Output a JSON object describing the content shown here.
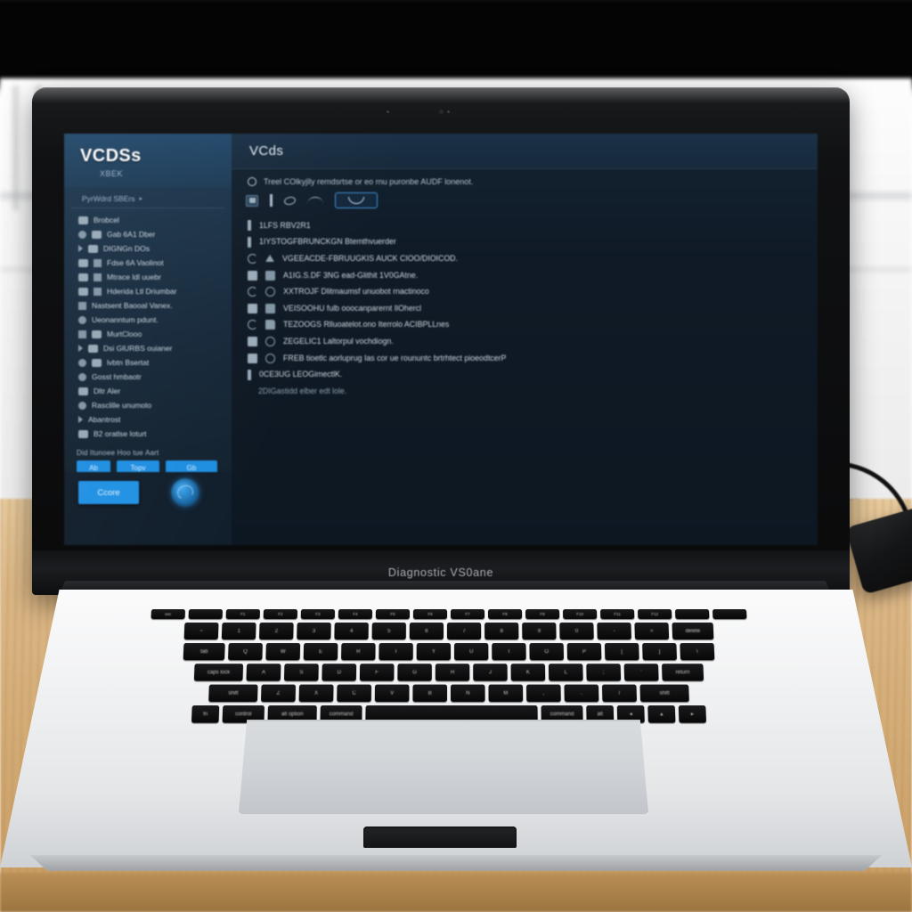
{
  "scene": {
    "device": "laptop",
    "lid_wordmark": "Diagnostic VS0ane"
  },
  "app": {
    "sidebar": {
      "title": "VCDSs",
      "subtitle": "XBEK",
      "group_label": "PyrWdrd SBErs",
      "group_caret": "▸",
      "items": [
        {
          "label": "Brobcel",
          "icon": "grid-icon"
        },
        {
          "label": "Gab 6A1 Dber",
          "icon": "cloud-icon"
        },
        {
          "label": "DIGNGn DOs",
          "icon": "key-icon"
        },
        {
          "label": "Fdse 6A Vaolinot",
          "icon": "monitor-icon"
        },
        {
          "label": "Mtrace ldl uuebr",
          "icon": "window-icon"
        },
        {
          "label": "Hderida Ltl Driumbar",
          "icon": "folder-icon"
        },
        {
          "label": "Nastsent Baooal Vanex.",
          "icon": "flag-icon"
        },
        {
          "label": "Ueonanntum pdunt.",
          "icon": "dot-icon"
        },
        {
          "label": "MurtClooo",
          "icon": "chip-icon"
        },
        {
          "label": "Dsi GlURBS ouianer",
          "icon": "car-icon"
        },
        {
          "label": "lvbtn Bsertat",
          "icon": "list-icon"
        },
        {
          "label": "Gosst hmbaotr",
          "icon": "refresh-icon"
        },
        {
          "label": "Dltr Aler",
          "icon": "image-icon"
        },
        {
          "label": "Rasclille unumoto",
          "icon": "search-icon"
        },
        {
          "label": "Abantrost",
          "icon": "pointer-icon"
        },
        {
          "label": "B2 oratlse loturt",
          "icon": "stack-icon"
        }
      ],
      "footer_label": "Did Itunoee Hoo tue Aart",
      "buttons": [
        {
          "label": "Ab"
        },
        {
          "label": "Topv"
        },
        {
          "label": "Gb"
        }
      ],
      "primary_button": "Ccore",
      "badge": "vcds-logo-badge"
    },
    "main": {
      "title": "VCds",
      "notice": "Treel COlkyjlly remdsrtse or eo rnu puronbe AUDF lonenot.",
      "toolbar": {
        "icons": [
          "screen-icon",
          "probe-icon",
          "loop-icon",
          "wave-icon"
        ],
        "selected_icon": "scan-icon"
      },
      "rows": [
        {
          "text": "1LFS RBV2R1",
          "icon1": "bar-icon",
          "icon2": ""
        },
        {
          "text": "1IYSTOGFBRUNCKGN Btemthvuerder",
          "icon1": "pin-icon",
          "icon2": ""
        },
        {
          "text": "VGEEACDE-FBRUUGKIS AUCK CIOO/DIOICOD.",
          "icon1": "cap-icon",
          "icon2": "house-icon"
        },
        {
          "text": "A1IG.S.DF 3NG ead-Glithit 1V0GAtne.",
          "icon1": "chip-icon",
          "icon2": "printer-icon"
        },
        {
          "text": "XXTROJF Dlitmaumsf unuobot rnactinoco",
          "icon1": "hook-icon",
          "icon2": "ring-icon"
        },
        {
          "text": "VEISOOHU fulb ooocanparernt IlOhercl",
          "icon1": "doc-icon",
          "icon2": "flag-icon"
        },
        {
          "text": "TEZOOGS Rlluoatelot.ono Iterrolo ACIBPLLnes",
          "icon1": "ring-icon",
          "icon2": "folder-icon"
        },
        {
          "text": "ZEGELIC1 Laltorpul vochdiogn.",
          "icon1": "car-icon",
          "icon2": "ring-icon"
        },
        {
          "text": "FREB tioetlc aorluprug Ias cor ue roununtc brtrhtect pioeodtcerP",
          "icon1": "undo-icon",
          "icon2": "ring-icon"
        },
        {
          "text": "0CE3UG LEOGimectlK.",
          "icon1": "bracket-icon",
          "icon2": ""
        },
        {
          "text": "2DIGastidd elber edt lole.",
          "icon1": "",
          "icon2": "",
          "dim": true
        }
      ]
    }
  },
  "colors": {
    "accent_blue": "#2191e3",
    "sidebar_top": "#21486a",
    "panel_bg": "#0d1722",
    "screen_bg": "#0e1722",
    "text_primary": "#e8eef4",
    "text_secondary": "#b6c6d4"
  },
  "keyboard": {
    "fn_row": [
      "esc",
      "",
      "F1",
      "F2",
      "F3",
      "F4",
      "F5",
      "F6",
      "F7",
      "F8",
      "F9",
      "F10",
      "F11",
      "F12",
      "",
      ""
    ],
    "row1": [
      "~",
      "1",
      "2",
      "3",
      "4",
      "5",
      "6",
      "7",
      "8",
      "9",
      "0",
      "-",
      "=",
      "delete"
    ],
    "row2": [
      "tab",
      "Q",
      "W",
      "E",
      "R",
      "T",
      "Y",
      "U",
      "I",
      "O",
      "P",
      "[",
      "]",
      "\\"
    ],
    "row3": [
      "caps lock",
      "A",
      "S",
      "D",
      "F",
      "G",
      "H",
      "J",
      "K",
      "L",
      ";",
      "'",
      "return"
    ],
    "row4": [
      "shift",
      "Z",
      "X",
      "C",
      "V",
      "B",
      "N",
      "M",
      ",",
      ".",
      "/",
      "shift"
    ],
    "row5": [
      "fn",
      "control",
      "alt option",
      "command",
      "",
      "command",
      "alt",
      "◂",
      "▴",
      "▸"
    ]
  }
}
